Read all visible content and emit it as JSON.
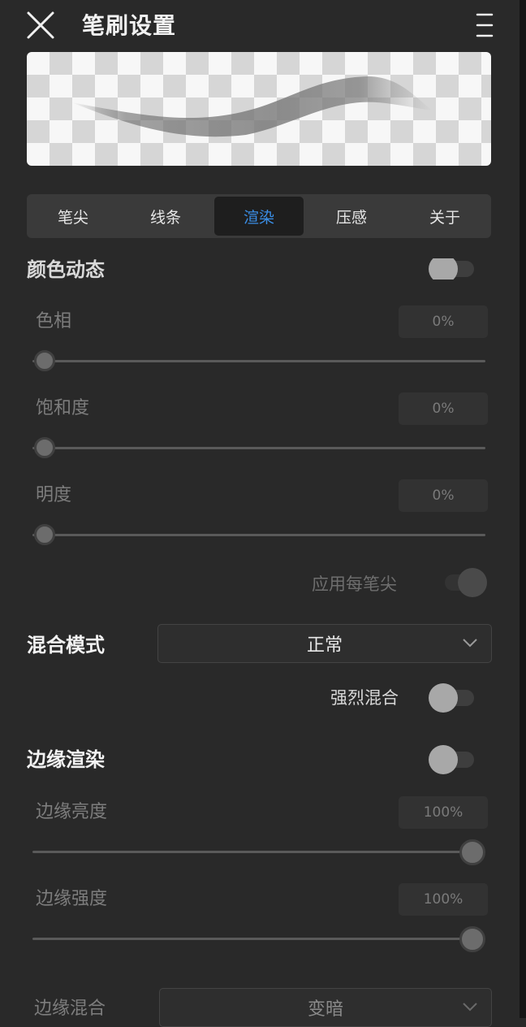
{
  "header": {
    "title": "笔刷设置"
  },
  "tabs": [
    {
      "label": "笔尖",
      "active": false
    },
    {
      "label": "线条",
      "active": false
    },
    {
      "label": "渲染",
      "active": true
    },
    {
      "label": "压感",
      "active": false
    },
    {
      "label": "关于",
      "active": false
    }
  ],
  "color_dynamics": {
    "title": "颜色动态",
    "enabled": false,
    "hue": {
      "label": "色相",
      "value": "0%",
      "level": 0
    },
    "saturation": {
      "label": "饱和度",
      "value": "0%",
      "level": 0
    },
    "brightness": {
      "label": "明度",
      "value": "0%",
      "level": 0
    },
    "per_tip": {
      "label": "应用每笔尖",
      "enabled": false
    }
  },
  "blend_mode": {
    "label": "混合模式",
    "value": "正常",
    "strong_blend": {
      "label": "强烈混合",
      "enabled": false
    }
  },
  "edge_render": {
    "title": "边缘渲染",
    "enabled": false,
    "edge_brightness": {
      "label": "边缘亮度",
      "value": "100%",
      "level": 1
    },
    "edge_strength": {
      "label": "边缘强度",
      "value": "100%",
      "level": 1
    },
    "edge_blend": {
      "label": "边缘混合",
      "value": "变暗"
    }
  },
  "colors": {
    "accent": "#3a8ee6",
    "background": "#292929"
  }
}
